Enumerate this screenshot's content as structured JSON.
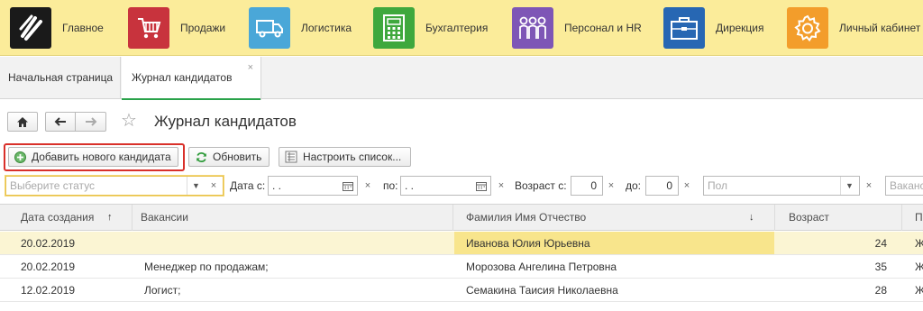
{
  "sections": [
    {
      "id": "main",
      "label": "Главное",
      "icon": "logo-icon",
      "color": "#1a1a1a"
    },
    {
      "id": "sales",
      "label": "Продажи",
      "icon": "cart-icon",
      "color": "#c8333d"
    },
    {
      "id": "logistics",
      "label": "Логистика",
      "icon": "truck-icon",
      "color": "#4aa7d8"
    },
    {
      "id": "accounting",
      "label": "Бухгалтерия",
      "icon": "calculator-icon",
      "color": "#3fa83d"
    },
    {
      "id": "hr",
      "label": "Персонал и HR",
      "icon": "people-icon",
      "color": "#7e56b6"
    },
    {
      "id": "direction",
      "label": "Дирекция",
      "icon": "briefcase-icon",
      "color": "#2767b3"
    },
    {
      "id": "cabinet",
      "label": "Личный кабинет",
      "icon": "gear-icon",
      "color": "#f39d2b"
    }
  ],
  "tabs": {
    "home": "Начальная страница",
    "active": "Журнал кандидатов",
    "close": "×"
  },
  "header": {
    "title": "Журнал кандидатов"
  },
  "commands": {
    "add": "Добавить нового кандидата",
    "refresh": "Обновить",
    "settings": "Настроить список..."
  },
  "filters": {
    "status_placeholder": "Выберите статус",
    "date_from_label": "Дата с:",
    "date_from_value": " .  .",
    "date_to_label": "по:",
    "date_to_value": " .  .",
    "age_from_label": "Возраст с:",
    "age_from_value": "0",
    "age_to_label": "до:",
    "age_to_value": "0",
    "gender_placeholder": "Пол",
    "vacancy_placeholder": "Ваканс",
    "clear": "×"
  },
  "table": {
    "columns": [
      "Дата создания",
      "Вакансии",
      "Фамилия Имя Отчество",
      "Возраст",
      "П"
    ],
    "sort_asc": "↑",
    "sort_desc": "↓",
    "rows": [
      {
        "date": "20.02.2019",
        "vacancy": "",
        "fio": "Иванова Юлия Юрьевна",
        "age": "24",
        "extra": "Ж"
      },
      {
        "date": "20.02.2019",
        "vacancy": "Менеджер по продажам;",
        "fio": "Морозова Ангелина Петровна",
        "age": "35",
        "extra": "Ж"
      },
      {
        "date": "12.02.2019",
        "vacancy": "Логист;",
        "fio": "Семакина Таисия Николаевна",
        "age": "28",
        "extra": "Ж"
      }
    ]
  },
  "colors": {
    "section_bar": "#fbec9a",
    "accent_green": "#2aa24a",
    "highlight_red": "#d9302a",
    "selected_row": "#fbf5d3",
    "selected_cell": "#f8e58c"
  }
}
